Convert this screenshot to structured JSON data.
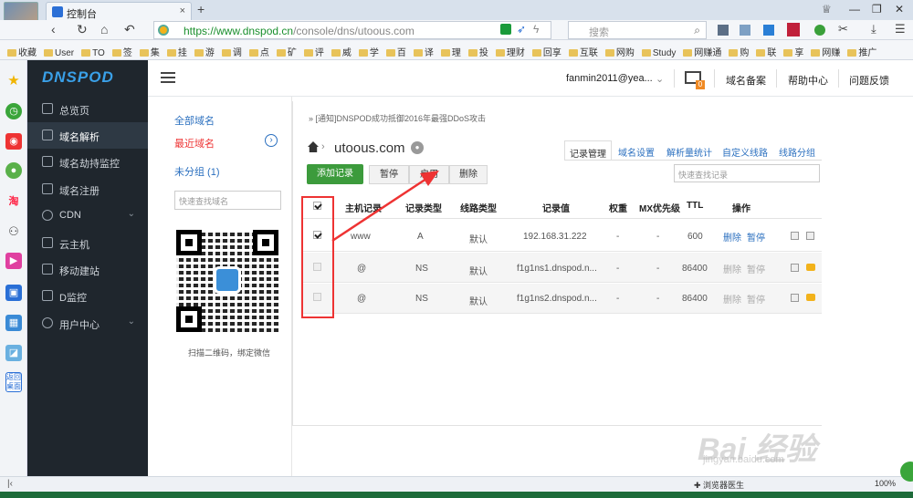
{
  "browser": {
    "tab_title": "控制台",
    "new_tab": "+",
    "url_host": "https://www.dnspod.cn",
    "url_path": "/console/dns/utoous.com",
    "search_placeholder": "搜索",
    "zoom": "100%",
    "status_item": "浏览器医生"
  },
  "bookmarks": [
    "收藏",
    "User",
    "TO",
    "签",
    "集",
    "挂",
    "游",
    "调",
    "点",
    "矿",
    "评",
    "威",
    "学",
    "百",
    "译",
    "理",
    "投",
    "理财",
    "回享",
    "互联",
    "网购",
    "Study",
    "网赚通",
    "购",
    "联",
    "享",
    "网赚",
    "推广"
  ],
  "sidebar": {
    "logo": "DNSPOD",
    "items": [
      {
        "label": "总览页"
      },
      {
        "label": "域名解析"
      },
      {
        "label": "域名劫持监控"
      },
      {
        "label": "域名注册"
      },
      {
        "label": "CDN"
      },
      {
        "label": "云主机"
      },
      {
        "label": "移动建站"
      },
      {
        "label": "D监控"
      },
      {
        "label": "用户中心"
      }
    ]
  },
  "header": {
    "user": "fanmin2011@yea...",
    "mail_count": "0",
    "links": [
      "域名备案",
      "帮助中心",
      "问题反馈"
    ]
  },
  "domain_panel": {
    "all": "全部域名",
    "recent": "最近域名",
    "ungrouped": "未分组 (1)",
    "search_placeholder": "快速查找域名",
    "qr_caption": "扫描二维码，绑定微信"
  },
  "main": {
    "notice": "» [通知]DNSPOD成功抵御2016年最强DDoS攻击",
    "domain": "utoous.com",
    "tabs": [
      "记录管理",
      "域名设置",
      "解析量统计",
      "自定义线路",
      "线路分组"
    ],
    "add_button": "添加记录",
    "buttons": [
      "暂停",
      "启用",
      "删除"
    ],
    "search_placeholder": "快速查找记录"
  },
  "table": {
    "headers": [
      "主机记录",
      "记录类型",
      "线路类型",
      "记录值",
      "权重",
      "MX优先级",
      "TTL",
      "操作"
    ],
    "rows": [
      {
        "host": "www",
        "type": "A",
        "line": "默认",
        "value": "192.168.31.222",
        "weight": "-",
        "mx": "-",
        "ttl": "600",
        "del": "删除",
        "pause": "暂停"
      },
      {
        "host": "@",
        "type": "NS",
        "line": "默认",
        "value": "f1g1ns1.dnspod.n...",
        "weight": "-",
        "mx": "-",
        "ttl": "86400",
        "del": "删除",
        "pause": "暂停"
      },
      {
        "host": "@",
        "type": "NS",
        "line": "默认",
        "value": "f1g1ns2.dnspod.n...",
        "weight": "-",
        "mx": "-",
        "ttl": "86400",
        "del": "删除",
        "pause": "暂停"
      }
    ]
  },
  "watermark": {
    "logo": "Bai 经验",
    "url": "jingyan.baidu.com"
  },
  "colors": {
    "sidebar": "#1f262d",
    "green_button": "#3c9b3c",
    "link": "#2a6fbf",
    "annotation": "#e33333"
  }
}
